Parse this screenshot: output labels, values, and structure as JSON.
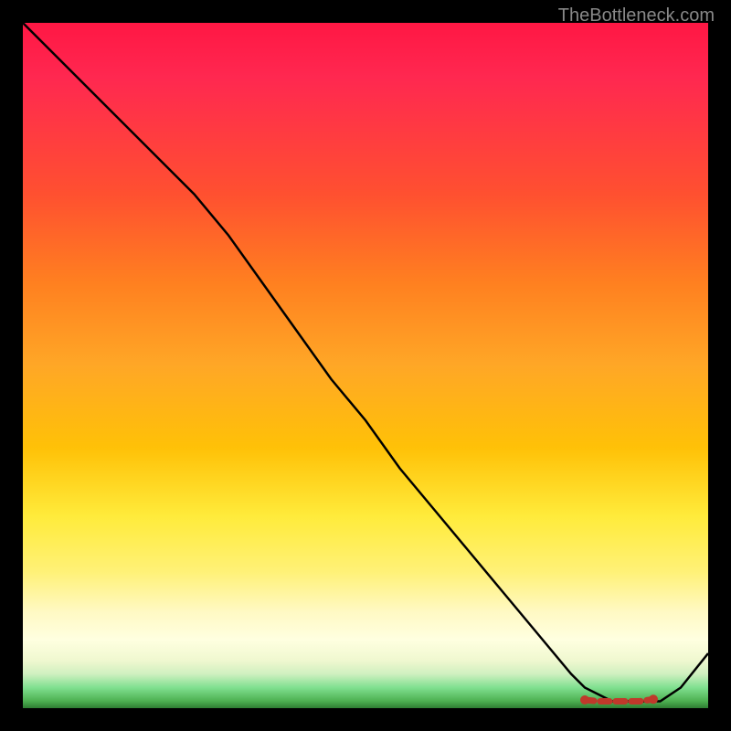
{
  "watermark": "TheBottleneck.com",
  "chart_data": {
    "type": "line",
    "title": "",
    "xlabel": "",
    "ylabel": "",
    "xlim": [
      0,
      100
    ],
    "ylim": [
      0,
      100
    ],
    "series": [
      {
        "name": "bottleneck-curve",
        "x": [
          0,
          5,
          10,
          15,
          20,
          25,
          30,
          35,
          40,
          45,
          50,
          55,
          60,
          65,
          70,
          75,
          80,
          82,
          84,
          86,
          88,
          90,
          93,
          96,
          100
        ],
        "y": [
          100,
          95,
          90,
          85,
          80,
          75,
          69,
          62,
          55,
          48,
          42,
          35,
          29,
          23,
          17,
          11,
          5,
          3,
          2,
          1,
          1,
          1,
          1,
          3,
          8
        ]
      },
      {
        "name": "optimal-markers",
        "x": [
          82,
          84,
          86,
          88,
          90,
          92
        ],
        "y": [
          1.2,
          1.0,
          1.0,
          1.0,
          1.0,
          1.3
        ]
      }
    ],
    "background_gradient": {
      "top": "#ff1744",
      "mid_upper": "#ffa726",
      "mid": "#ffeb3b",
      "mid_lower": "#fff9c4",
      "bottom": "#2e7d32"
    }
  }
}
